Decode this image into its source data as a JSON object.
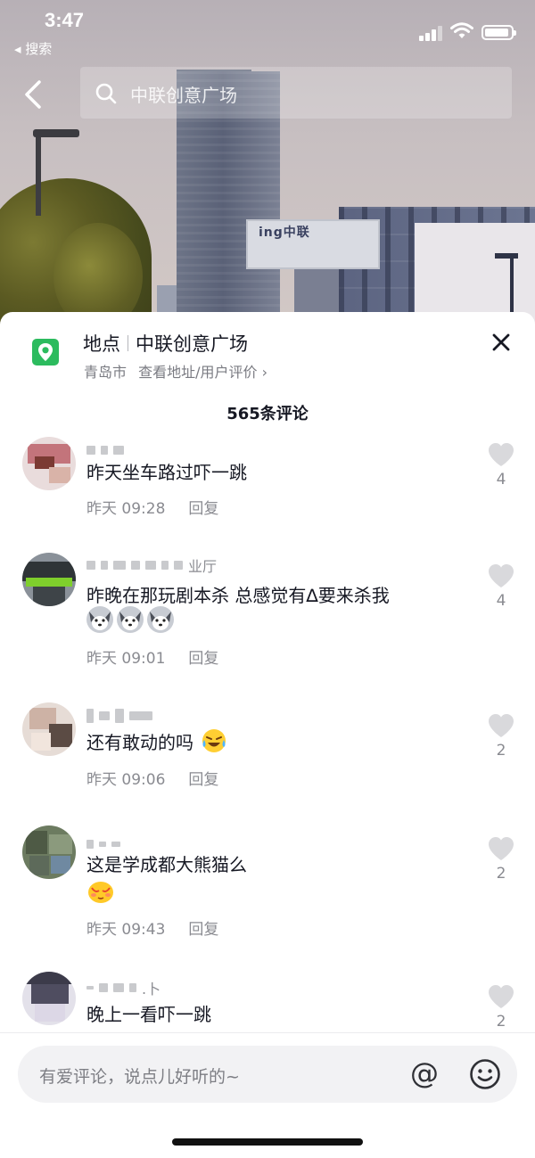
{
  "status_bar": {
    "time": "3:47",
    "back_app": "◂ 搜索"
  },
  "search": {
    "query": "中联创意广场"
  },
  "scene": {
    "sign_text": "ing中联"
  },
  "location": {
    "label": "地点",
    "name": "中联创意广场",
    "city": "青岛市",
    "link": "查看地址/用户评价 ›"
  },
  "comment_count": "565条评论",
  "comments": [
    {
      "text": "昨天坐车路过吓一跳",
      "time": "昨天 09:28",
      "reply": "回复",
      "likes": "4"
    },
    {
      "name_tail": "业厅",
      "text": "昨晚在那玩剧本杀 总感觉有∆要来杀我",
      "time": "昨天 09:01",
      "reply": "回复",
      "likes": "4",
      "emoji_count": 3
    },
    {
      "text": "还有敢动的吗",
      "time": "昨天 09:06",
      "reply": "回复",
      "likes": "2"
    },
    {
      "text": "这是学成都大熊猫么",
      "time": "昨天 09:43",
      "reply": "回复",
      "likes": "2"
    },
    {
      "name_tail": ".卜",
      "text": "晚上一看吓一跳",
      "likes": "2"
    }
  ],
  "input": {
    "placeholder": "有爱评论，说点儿好听的~",
    "at": "@"
  },
  "icons": {
    "location": "location-pin-icon",
    "close": "close-icon",
    "like": "heart-icon",
    "search": "search-icon",
    "back": "chevron-left-icon",
    "emoji": "smile-icon"
  },
  "colors": {
    "accent_green": "#2cbb5e",
    "text_primary": "#161823",
    "text_secondary": "#8a8b91"
  }
}
